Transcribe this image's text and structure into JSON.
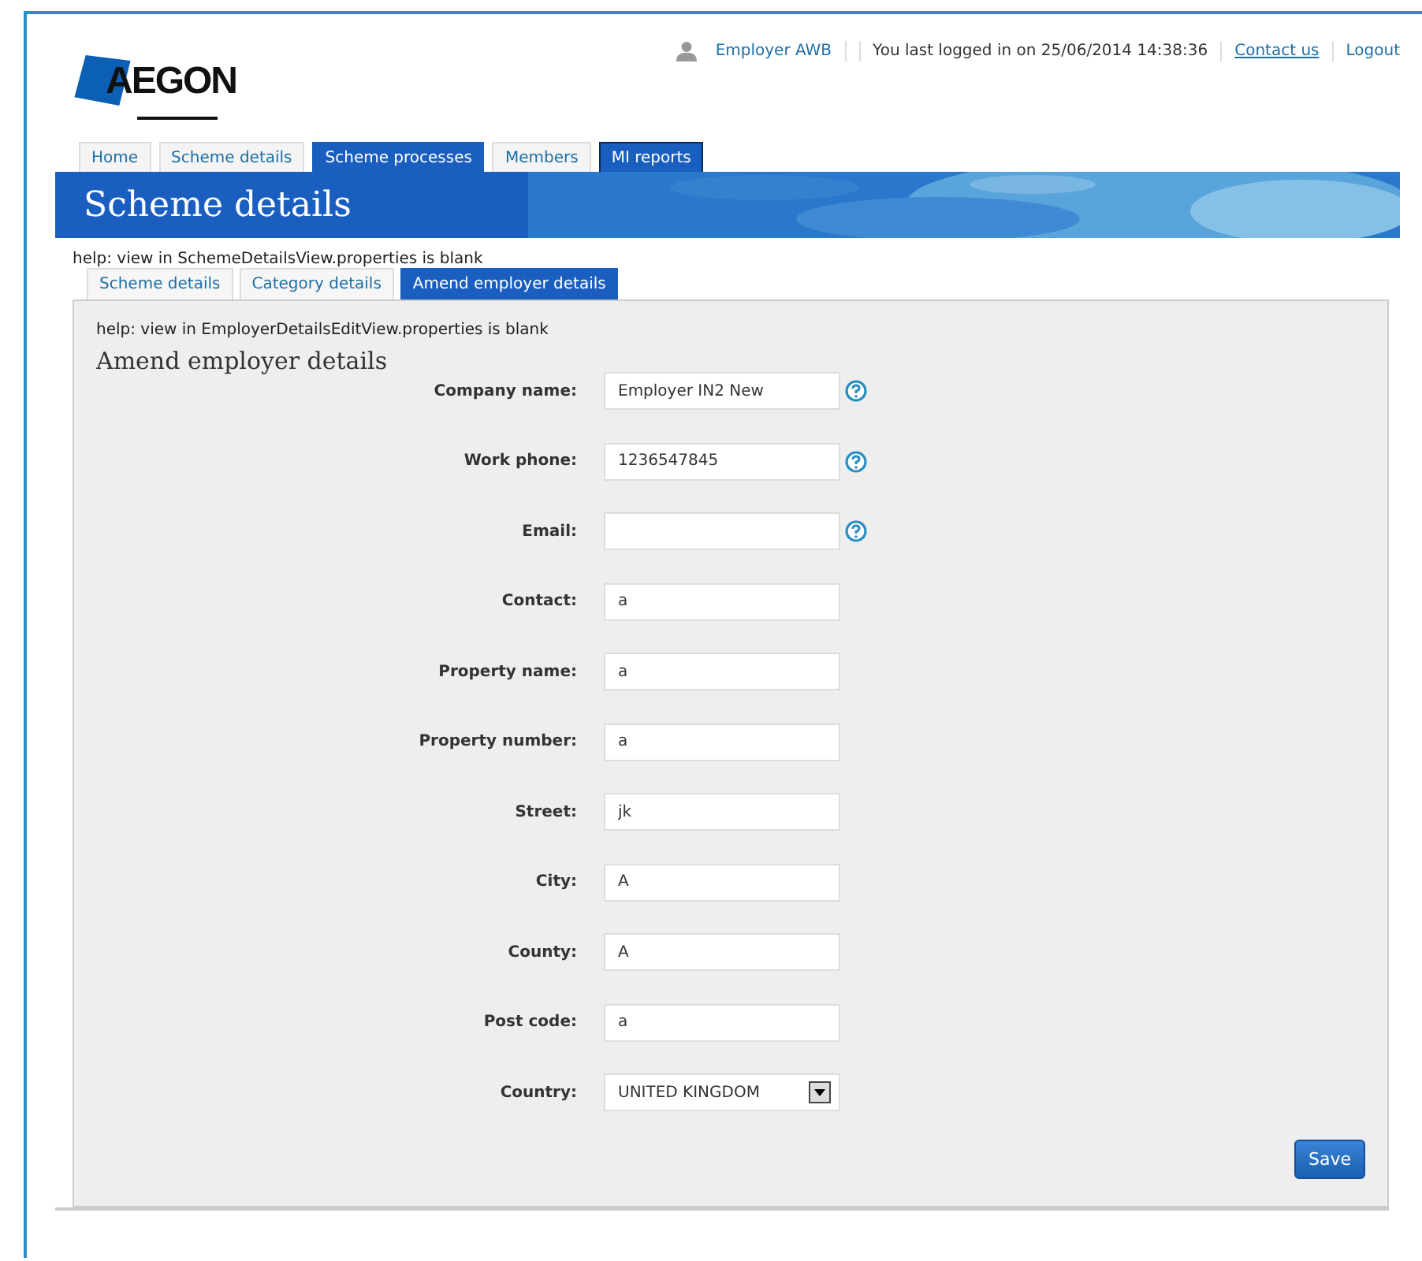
{
  "header": {
    "logo": "AEGON",
    "user": "Employer AWB",
    "last_login": "You last logged in on 25/06/2014 14:38:36",
    "links": [
      {
        "label": "Contact us",
        "underlined": true
      },
      {
        "label": "Logout",
        "underlined": false
      }
    ]
  },
  "main_tabs": [
    {
      "label": "Home",
      "selected": false,
      "highlighted": false
    },
    {
      "label": "Scheme details",
      "selected": false,
      "highlighted": false
    },
    {
      "label": "Scheme processes",
      "selected": false,
      "highlighted": true
    },
    {
      "label": "Members",
      "selected": false,
      "highlighted": false
    },
    {
      "label": "MI reports",
      "selected": true,
      "highlighted": false
    }
  ],
  "banner": {
    "title": "Scheme details"
  },
  "help_text": "help: view in SchemeDetailsView.properties is blank",
  "sub_tabs": [
    {
      "label": "Scheme details",
      "selected": false
    },
    {
      "label": "Category details",
      "selected": false
    },
    {
      "label": "Amend employer details",
      "selected": true
    }
  ],
  "panel": {
    "help_text": "help: view in EmployerDetailsEditView.properties is blank",
    "heading": "Amend employer details",
    "fields": [
      {
        "label": "Company name:",
        "kind": "text",
        "value": "Employer IN2 New",
        "help": true
      },
      {
        "label": "Work phone:",
        "kind": "text",
        "value": "1236547845",
        "help": true
      },
      {
        "label": "Email:",
        "kind": "text",
        "help": true
      },
      {
        "label": "Contact:",
        "kind": "text",
        "value": "a",
        "help": false
      },
      {
        "label": "Property name:",
        "kind": "text",
        "value": "a",
        "help": false
      },
      {
        "label": "Property number:",
        "kind": "text",
        "value": "a",
        "help": false
      },
      {
        "label": "Street:",
        "kind": "text",
        "value": "jk",
        "help": false
      },
      {
        "label": "City:",
        "kind": "text",
        "value": "A",
        "help": false
      },
      {
        "label": "County:",
        "kind": "text",
        "value": "A",
        "help": false
      },
      {
        "label": "Post code:",
        "kind": "text",
        "value": "a",
        "help": false
      },
      {
        "label": "Country:",
        "kind": "select",
        "value": "UNITED KINGDOM",
        "help": false
      }
    ],
    "save_button": "Save"
  }
}
